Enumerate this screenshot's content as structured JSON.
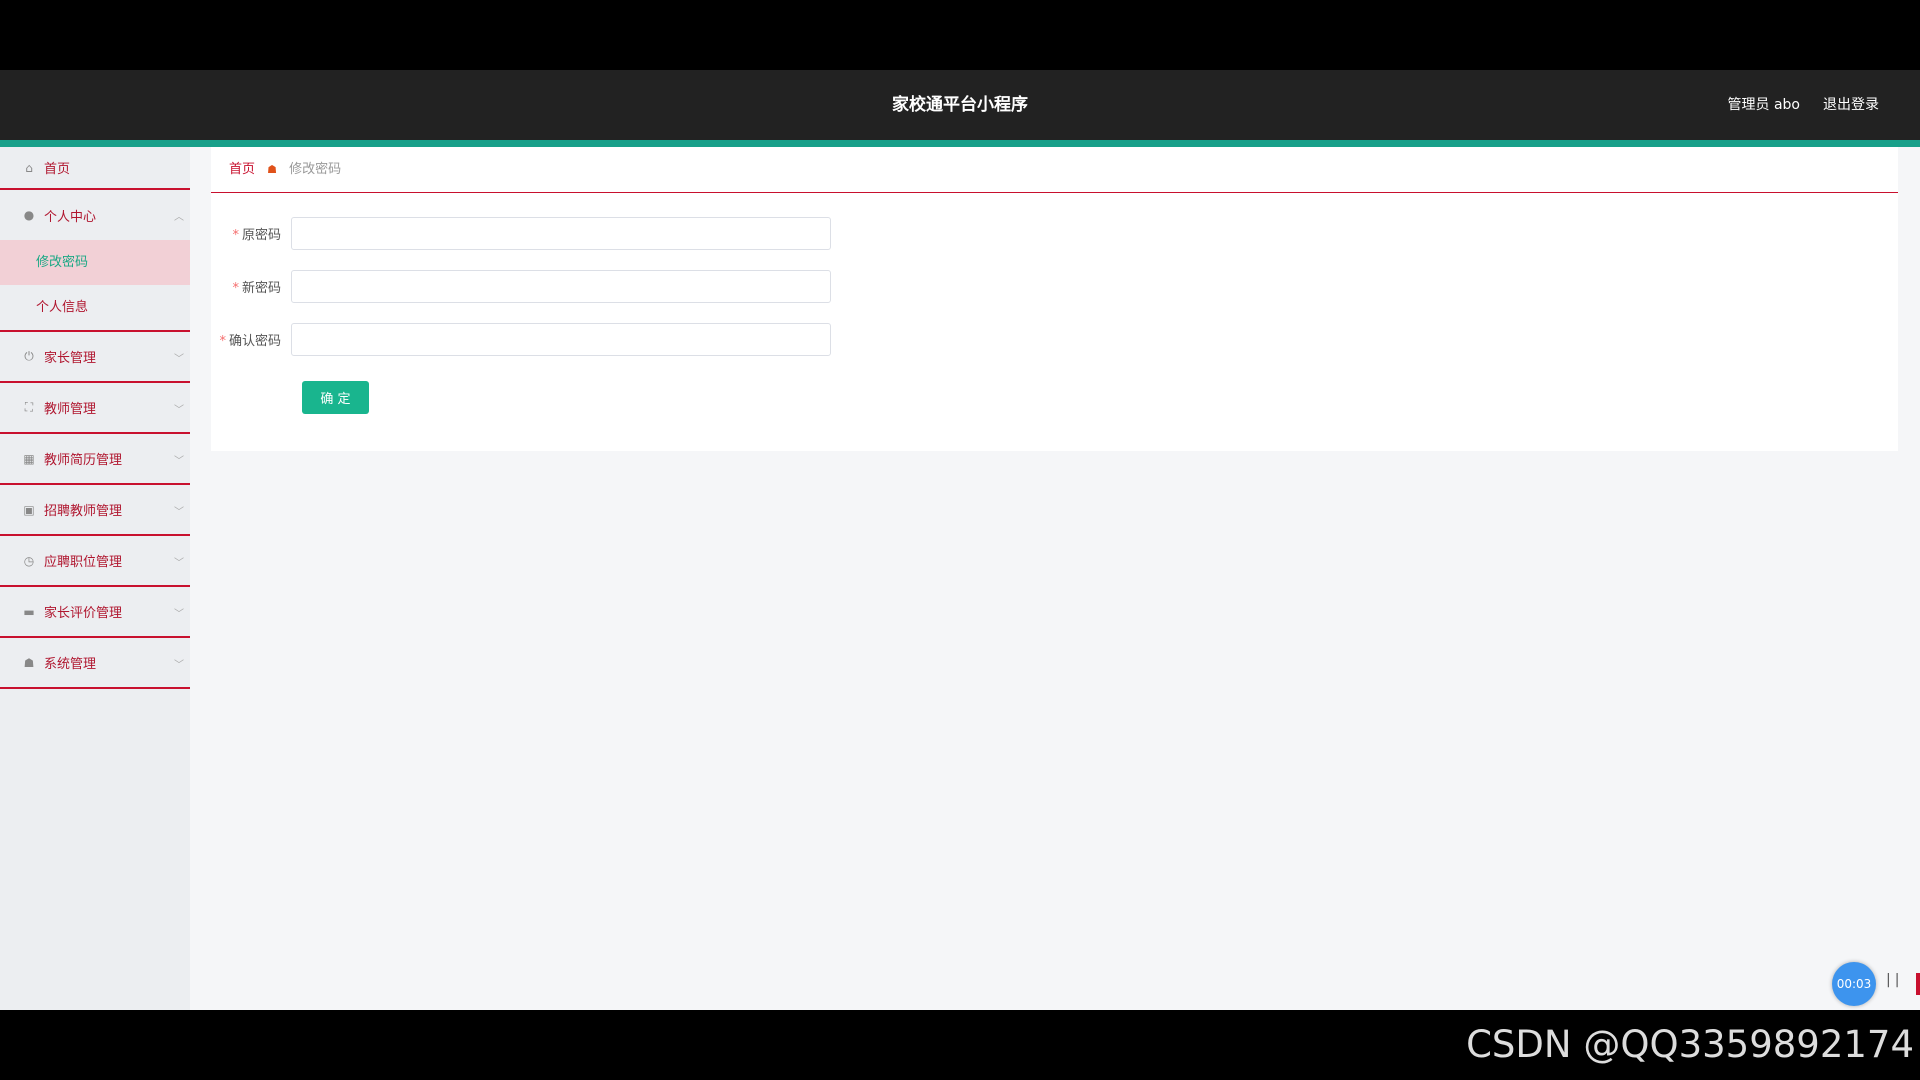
{
  "header": {
    "title": "家校通平台小程序",
    "user": "管理员 abo",
    "logout": "退出登录"
  },
  "sidebar": {
    "items": [
      {
        "label": "首页",
        "icon": "home-icon"
      },
      {
        "label": "个人中心",
        "icon": "user-icon"
      },
      {
        "label": "家长管理",
        "icon": "power-icon"
      },
      {
        "label": "教师管理",
        "icon": "frame-icon"
      },
      {
        "label": "教师简历管理",
        "icon": "grid-icon"
      },
      {
        "label": "招聘教师管理",
        "icon": "chart-icon"
      },
      {
        "label": "应聘职位管理",
        "icon": "compass-icon"
      },
      {
        "label": "家长评价管理",
        "icon": "briefcase-icon"
      },
      {
        "label": "系统管理",
        "icon": "thumb-icon"
      }
    ],
    "personal_sub": [
      "修改密码",
      "个人信息"
    ]
  },
  "breadcrumb": {
    "home": "首页",
    "current": "修改密码"
  },
  "form": {
    "old_password_label": "原密码",
    "new_password_label": "新密码",
    "confirm_password_label": "确认密码",
    "required_mark": "*",
    "submit": "确 定"
  },
  "recorder": {
    "time": "00:03"
  },
  "watermark": "CSDN @QQ3359892174"
}
